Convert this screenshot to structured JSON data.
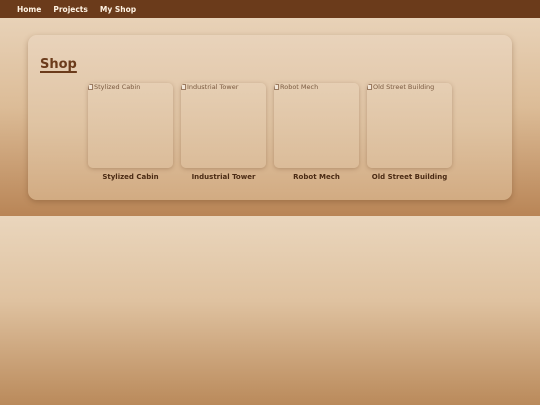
{
  "nav": {
    "items": [
      {
        "label": "Home"
      },
      {
        "label": "Projects"
      },
      {
        "label": "My Shop"
      }
    ]
  },
  "shop": {
    "title": "Shop",
    "products": [
      {
        "name": "Stylized Cabin",
        "image_alt": "Stylized Cabin"
      },
      {
        "name": "Industrial Tower",
        "image_alt": "Industrial Tower"
      },
      {
        "name": "Robot Mech",
        "image_alt": "Robot Mech"
      },
      {
        "name": "Old Street Building",
        "image_alt": "Old Street Building"
      }
    ]
  },
  "colors": {
    "navbar": "#6b3b1b",
    "accent_text": "#6b3b1b",
    "background_light": "#e8d2b8",
    "background_dark": "#b98556"
  }
}
